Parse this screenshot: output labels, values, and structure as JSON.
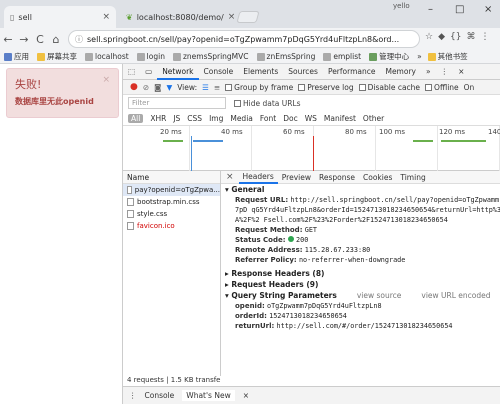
{
  "browser": {
    "tabs": [
      {
        "title": "sell",
        "close": "×"
      },
      {
        "title": "localhost:8080/demo/",
        "close": "×"
      }
    ],
    "user": "yello",
    "window_buttons": [
      "–",
      "□",
      "×"
    ],
    "address": "sell.springboot.cn/sell/pay?openid=oTgZpwamm7pDqG5Yrd4uFltzpLn8&ord...",
    "nav": [
      "←",
      "→",
      "C",
      "⌂"
    ]
  },
  "bookmarks": {
    "items": [
      "应用",
      "屏幕共享",
      "localhost",
      "login",
      "znemsSpringMVC",
      "znEmsSpring",
      "emplist",
      "管理中心"
    ],
    "other": "其他书签"
  },
  "page": {
    "alert_title": "失败!",
    "alert_message": "数据库里无此openid",
    "alert_close": "×"
  },
  "devtools": {
    "tabs": [
      "Elements",
      "Network",
      "Console",
      "Elements",
      "Sources",
      "Performance",
      "Memory"
    ],
    "toolbar": {
      "view_label": "View:",
      "group_by_frame": "Group by frame",
      "preserve_log": "Preserve log",
      "disable_cache": "Disable cache",
      "offline": "Offline",
      "online": "On"
    },
    "filter_placeholder": "Filter",
    "hide_data_urls": "Hide data URLs",
    "types": [
      "All",
      "XHR",
      "JS",
      "CSS",
      "Img",
      "Media",
      "Font",
      "Doc",
      "WS",
      "Manifest",
      "Other"
    ],
    "timeline_ticks": [
      "20 ms",
      "40 ms",
      "60 ms",
      "80 ms",
      "100 ms",
      "120 ms",
      "140"
    ],
    "requests_header": "Name",
    "requests": [
      {
        "name": "pay?openid=oTgZpwa...",
        "error": false
      },
      {
        "name": "bootstrap.min.css",
        "error": false
      },
      {
        "name": "style.css",
        "error": false
      },
      {
        "name": "favicon.ico",
        "error": true
      }
    ],
    "summary": "4 requests | 1.5 KB transfe...",
    "detail_tabs": [
      "×",
      "Headers",
      "Preview",
      "Response",
      "Cookies",
      "Timing"
    ],
    "general": {
      "title": "General",
      "request_url_label": "Request URL:",
      "request_url": "http://sell.springboot.cn/sell/pay?openid=oTgZpwamm7pD qG5Yrd4uFltzpLn8&orderId=1524713018234650654&returnUrl=http%3A%2F%2 Fsell.com%2F%23%2Forder%2F1524713018234650654",
      "method_label": "Request Method:",
      "method": "GET",
      "status_label": "Status Code:",
      "status": "200",
      "remote_label": "Remote Address:",
      "remote": "115.28.67.233:80",
      "referrer_label": "Referrer Policy:",
      "referrer": "no-referrer-when-downgrade"
    },
    "response_headers": "Response Headers (8)",
    "request_headers": "Request Headers (9)",
    "query": {
      "title": "Query String Parameters",
      "view_source": "view source",
      "view_url_encoded": "view URL encoded",
      "params": [
        {
          "key": "openid:",
          "value": "oTgZpwamm7pDqG5Yrd4uFltzpLn8"
        },
        {
          "key": "orderId:",
          "value": "1524713018234650654"
        },
        {
          "key": "returnUrl:",
          "value": "http://sell.com/#/order/1524713018234650654"
        }
      ]
    },
    "drawer": [
      "⋮",
      "Console",
      "What's New",
      "×"
    ],
    "colors": {
      "accent": "#1a73e8",
      "status_ok": "#2ea44f",
      "error": "#d10000"
    }
  }
}
